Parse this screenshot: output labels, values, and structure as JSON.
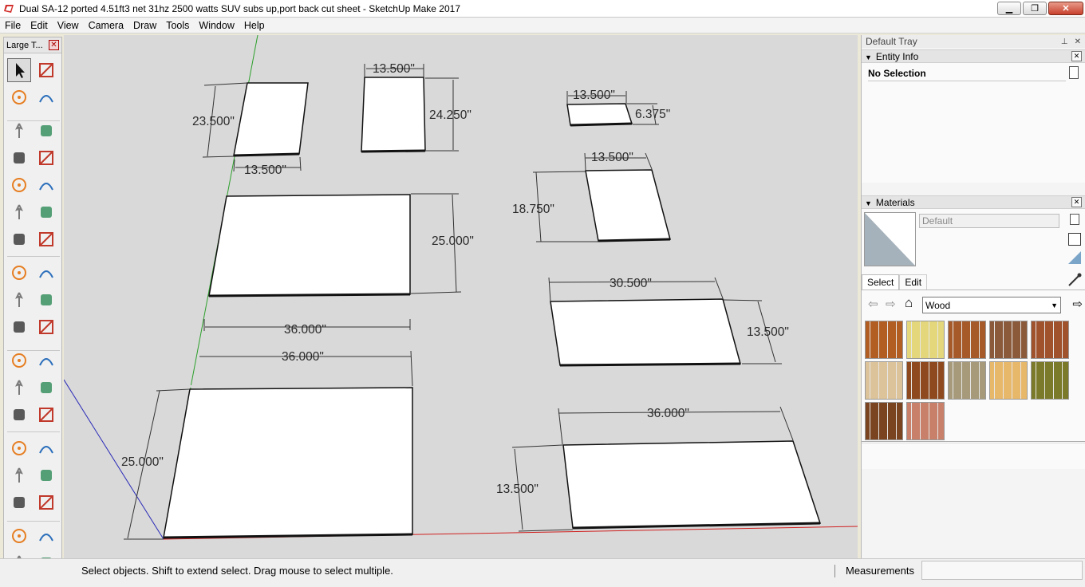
{
  "window": {
    "title": "Dual SA-12 ported 4.51ft3 net 31hz 2500 watts SUV subs up,port back cut sheet - SketchUp Make 2017",
    "minimize_label": "▁",
    "maximize_label": "❐",
    "close_label": "✕"
  },
  "menu": [
    "File",
    "Edit",
    "View",
    "Camera",
    "Draw",
    "Tools",
    "Window",
    "Help"
  ],
  "toolbar": {
    "title": "Large T...",
    "close_label": "✕",
    "tools": [
      "select-tool",
      "component-tool",
      "paint-bucket-tool",
      "eraser-tool",
      "line-tool",
      "freehand-tool",
      "rectangle-tool",
      "rotated-rectangle-tool",
      "circle-tool",
      "polygon-tool",
      "arc-tool",
      "pie-tool",
      "two-point-arc-tool",
      "three-point-arc-tool",
      "move-tool",
      "push-pull-tool",
      "rotate-tool",
      "follow-me-tool",
      "scale-tool",
      "offset-tool",
      "tape-measure-tool",
      "dimension-tool",
      "protractor-tool",
      "text-tool",
      "axes-tool",
      "3d-text-tool",
      "orbit-tool",
      "pan-tool",
      "zoom-tool",
      "zoom-window-tool",
      "zoom-extents-tool",
      "previous-view-tool",
      "position-camera-tool",
      "look-around-tool",
      "walk-tool",
      "section-plane-tool"
    ]
  },
  "dimensions": [
    "23.500\"",
    "13.500\"",
    "13.500\"",
    "24.250\"",
    "13.500\"",
    "6.375\"",
    "13.500\"",
    "18.750\"",
    "25.000\"",
    "36.000\"",
    "36.000\"",
    "25.000\"",
    "30.500\"",
    "13.500\"",
    "36.000\"",
    "13.500\""
  ],
  "tray": {
    "title": "Default Tray",
    "pin_label": "📌",
    "close_label": "✕",
    "entity_info": {
      "label": "Entity Info",
      "selection": "No Selection"
    },
    "materials": {
      "label": "Materials",
      "material_name": "Default",
      "tabs": [
        "Select",
        "Edit"
      ],
      "library": "Wood",
      "swatch_colors": [
        "#b25d22",
        "#e3d67b",
        "#a65a2a",
        "#8a5a3a",
        "#a0522d",
        "#dcc39a",
        "#8e4a1e",
        "#a69a7a",
        "#e8b86a",
        "#7a7a2a",
        "#7a4420",
        "#c8806a"
      ]
    }
  },
  "status": {
    "hint": "Select objects. Shift to extend select. Drag mouse to select multiple.",
    "measurements_label": "Measurements",
    "measurements_value": ""
  }
}
